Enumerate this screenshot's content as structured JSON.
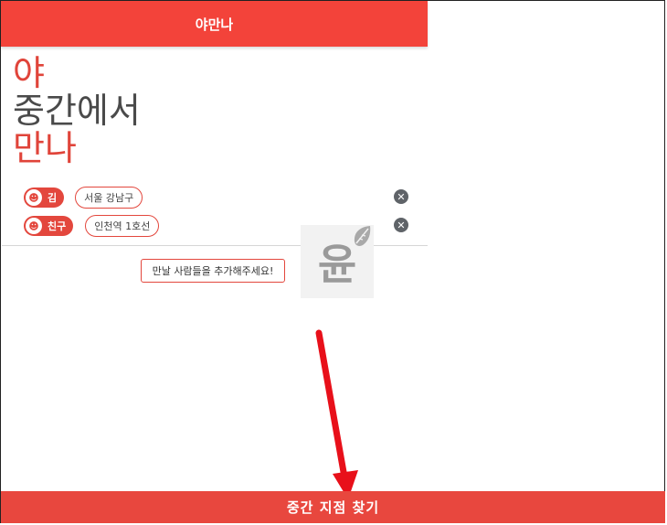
{
  "app_bar": {
    "title": "야만나"
  },
  "hero": {
    "line1": "야",
    "line2": "중간에서",
    "line3": "만나"
  },
  "people": [
    {
      "name": "김",
      "place": "서울 강남구"
    },
    {
      "name": "친구",
      "place": "인천역 1호선"
    }
  ],
  "remove_icon": "✕",
  "add_button": {
    "label": "만날 사람들을 추가해주세요!"
  },
  "watermark": {
    "glyph": "윤"
  },
  "bottom_button": {
    "label": "중간 지점 찾기"
  },
  "colors": {
    "accent": "#f3433a",
    "hero_gray": "#4a4a4a",
    "annotation_arrow": "#e8101a"
  }
}
